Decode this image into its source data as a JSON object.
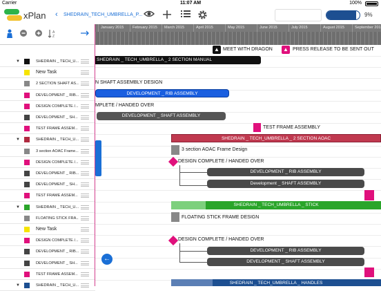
{
  "status": {
    "carrier": "Carrier",
    "time": "11:07 AM",
    "battery": "100%"
  },
  "toolbar": {
    "app_name": "xPlan",
    "back_glyph": "‹",
    "doc_title": "SHEDRAIN_TECH_UMBRELLA_P...",
    "progress_percent": "9%",
    "progress_value": 0.9,
    "icons": [
      "eye-icon",
      "plus-icon",
      "list-icon",
      "gear-icon"
    ]
  },
  "timeline": {
    "months": [
      "January 2015",
      "February 2015",
      "March 2015",
      "April 2015",
      "May 2015",
      "June 2015",
      "July 2015",
      "August 2015",
      "September 2015"
    ]
  },
  "legend": {
    "meet": "MEET WITH DRAGON",
    "press": "PRESS RELEASE TO BE SENT OUT"
  },
  "rows": [
    {
      "label": "SHEDRAIN _ TECH_U...",
      "color": "#111111",
      "tri": "▼",
      "big": false
    },
    {
      "label": "New Task",
      "color": "#f6e400",
      "tri": "",
      "big": true
    },
    {
      "label": "2 SECTION SHAFT AS...",
      "color": "#888888",
      "tri": "",
      "big": false
    },
    {
      "label": "DEVELOPMENT _ RIB...",
      "color": "#e0107c",
      "tri": "",
      "big": false
    },
    {
      "label": "DESIGN COMPLETE /...",
      "color": "#e0107c",
      "tri": "",
      "big": false
    },
    {
      "label": "DEVELOPMENT _ SH...",
      "color": "#444444",
      "tri": "",
      "big": false
    },
    {
      "label": "TEST FRAME ASSEM...",
      "color": "#e0107c",
      "tri": "",
      "big": false
    },
    {
      "label": "SHEDRAIN _ TECH_U...",
      "color": "#b02a40",
      "tri": "▼",
      "big": false
    },
    {
      "label": "3 section AOAC Frame...",
      "color": "#888888",
      "tri": "",
      "big": false
    },
    {
      "label": "DESIGN COMPLETE /...",
      "color": "#e0107c",
      "tri": "",
      "big": false
    },
    {
      "label": "DEVELOPMENT _ RIB...",
      "color": "#444444",
      "tri": "",
      "big": false
    },
    {
      "label": "DEVELOPMENT _ SH...",
      "color": "#444444",
      "tri": "",
      "big": false
    },
    {
      "label": "TEST FRAME ASSEM...",
      "color": "#e0107c",
      "tri": "",
      "big": false
    },
    {
      "label": "SHEDRAIN _ TECH_U...",
      "color": "#2aa52a",
      "tri": "▼",
      "big": false
    },
    {
      "label": "FLOATING STICK FRA...",
      "color": "#888888",
      "tri": "",
      "big": false
    },
    {
      "label": "New Task",
      "color": "#f6e400",
      "tri": "",
      "big": true
    },
    {
      "label": "DESIGN COMPLETE /...",
      "color": "#e0107c",
      "tri": "",
      "big": false
    },
    {
      "label": "DEVELOPMENT _ RIB...",
      "color": "#444444",
      "tri": "",
      "big": false
    },
    {
      "label": "DEVELOPMENT _ SH...",
      "color": "#444444",
      "tri": "",
      "big": false
    },
    {
      "label": "TEST FRAME ASSEM...",
      "color": "#e0107c",
      "tri": "",
      "big": false
    },
    {
      "label": "SHEDRAIN _ TECH_U...",
      "color": "#1d4f91",
      "tri": "▼",
      "big": false
    }
  ],
  "bars": [
    {
      "label": "SHEDRAIN _ TECH_UMBRELLA _ 2 SECTION  MANUAL",
      "color": "#111111"
    },
    {
      "label": "DEVELOPMENT _ RIB ASSEMBLY",
      "color": "#1a5fe0"
    },
    {
      "label": "DEVELOPMENT _ SHAFT ASSEMBLY",
      "color": "#555555"
    },
    {
      "label": "SHEDRAIN _ TECH_UMBRELLA _ 2 SECTION AOAC",
      "color": "#c0394f"
    },
    {
      "label": "DEVELOPMENT _ RIB ASSEMBLY",
      "color": "#4a4a4a"
    },
    {
      "label": "Development _ SHAFT ASSEMBLY",
      "color": "#4a4a4a"
    },
    {
      "label": "SHEDRAIN _ TECH_UMBRELLA _ STICK",
      "color": "#2aa52a"
    },
    {
      "label": "DEVELOPMENT _ RIB ASSEMBLY",
      "color": "#4a4a4a"
    },
    {
      "label": "DEVELOPMENT _ SHAFT ASSEMBLY",
      "color": "#4a4a4a"
    },
    {
      "label": "SHEDRAIN _ TECH_UMBRELLA _ HANDLES",
      "color": "#1d4f91"
    }
  ],
  "texts": {
    "shaft_design": "N SHAFT ASSEMBLY DESIGN",
    "complete1": "MPLETE / HANDED OVER",
    "test_frame": "TEST FRAME ASSEMBLY",
    "aoac_design": "3 section AOAC Frame Design",
    "complete2": "DESIGN COMPLETE / HANDED OVER",
    "floating": "FLOATING STICK FRAME DESIGN",
    "complete3": "DESIGN COMPLETE / HANDED OVER"
  }
}
